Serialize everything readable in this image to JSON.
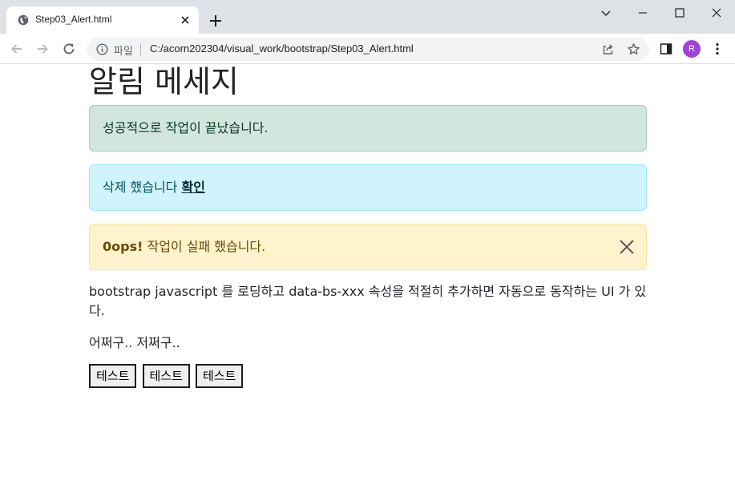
{
  "browser": {
    "tab_title": "Step03_Alert.html",
    "url_scheme_label": "파일",
    "url": "C:/acorn202304/visual_work/bootstrap/Step03_Alert.html",
    "profile_initial": "R",
    "profile_color": "#a142d8"
  },
  "page": {
    "title": "알림 메세지",
    "alerts": {
      "success": {
        "text": "성공적으로 작업이 끝났습니다."
      },
      "info": {
        "text": "삭제 했습니다 ",
        "link": "확인"
      },
      "warning": {
        "strong": "0ops!",
        "text": " 작업이 실패 했습니다."
      }
    },
    "paragraph": "bootstrap javascript 를 로딩하고 data-bs-xxx 속성을 적절히 추가하면 자동으로 동작하는 UI 가 있다.",
    "paragraph2": "어쩌구.. 저쩌구..",
    "buttons": [
      "테스트",
      "테스트",
      "테스트"
    ]
  },
  "colors": {
    "success_bg": "#d1e7dd",
    "info_bg": "#cff4fc",
    "warning_bg": "#fff3cd"
  }
}
